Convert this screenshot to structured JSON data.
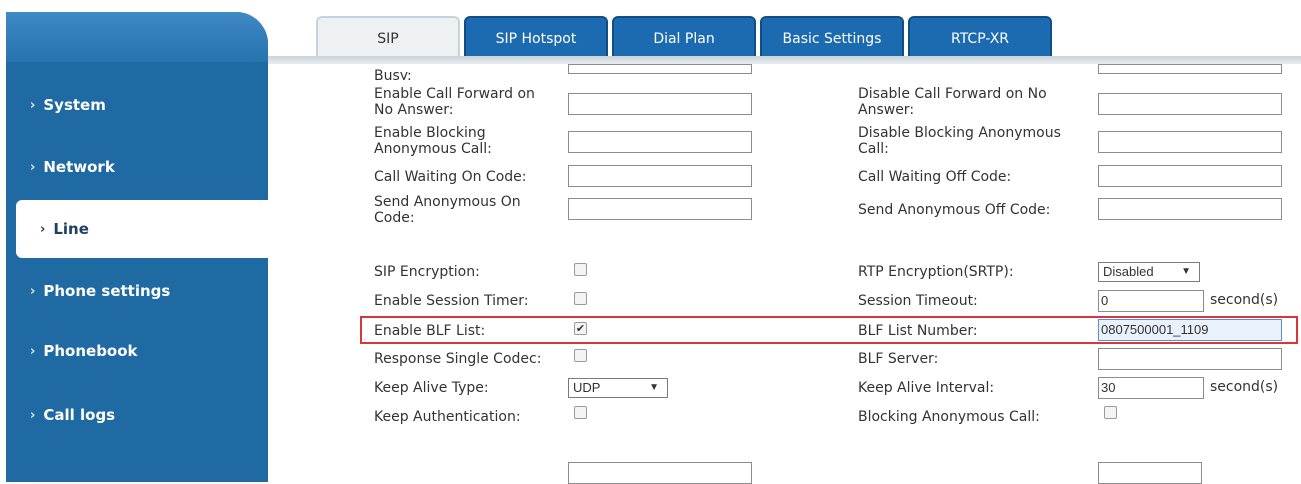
{
  "tabs": [
    "SIP",
    "SIP Hotspot",
    "Dial Plan",
    "Basic Settings",
    "RTCP-XR"
  ],
  "sidebar": {
    "items": [
      {
        "label": "System"
      },
      {
        "label": "Network"
      },
      {
        "label": "Line"
      },
      {
        "label": "Phone settings"
      },
      {
        "label": "Phonebook"
      },
      {
        "label": "Call logs"
      }
    ]
  },
  "form": {
    "busy_label": "Busy:",
    "fwd_no_answer_en": "Enable Call Forward on No Answer:",
    "fwd_no_answer_dis": "Disable Call Forward on No Answer:",
    "block_anon_en": "Enable Blocking Anonymous Call:",
    "block_anon_dis": "Disable Blocking Anonymous Call:",
    "cw_on": "Call Waiting On Code:",
    "cw_off": "Call Waiting Off Code:",
    "send_anon_on": "Send Anonymous On Code:",
    "send_anon_off": "Send Anonymous Off Code:",
    "sip_encryption": "SIP Encryption:",
    "rtp_encryption": "RTP Encryption(SRTP):",
    "rtp_encryption_value": "Disabled",
    "session_timer": "Enable Session Timer:",
    "session_timeout": "Session Timeout:",
    "session_timeout_value": "0",
    "blf_list": "Enable BLF List:",
    "blf_list_number": "BLF List Number:",
    "blf_list_number_value": "0807500001_1109",
    "single_codec": "Response Single Codec:",
    "blf_server": "BLF Server:",
    "keep_alive_type": "Keep Alive Type:",
    "keep_alive_type_value": "UDP",
    "keep_alive_interval": "Keep Alive Interval:",
    "keep_alive_interval_value": "30",
    "keep_auth": "Keep Authentication:",
    "blocking_anon": "Blocking Anonymous Call:",
    "seconds_unit": "second(s)",
    "check_mark": "✔"
  },
  "icons": {
    "chevron": "›"
  }
}
